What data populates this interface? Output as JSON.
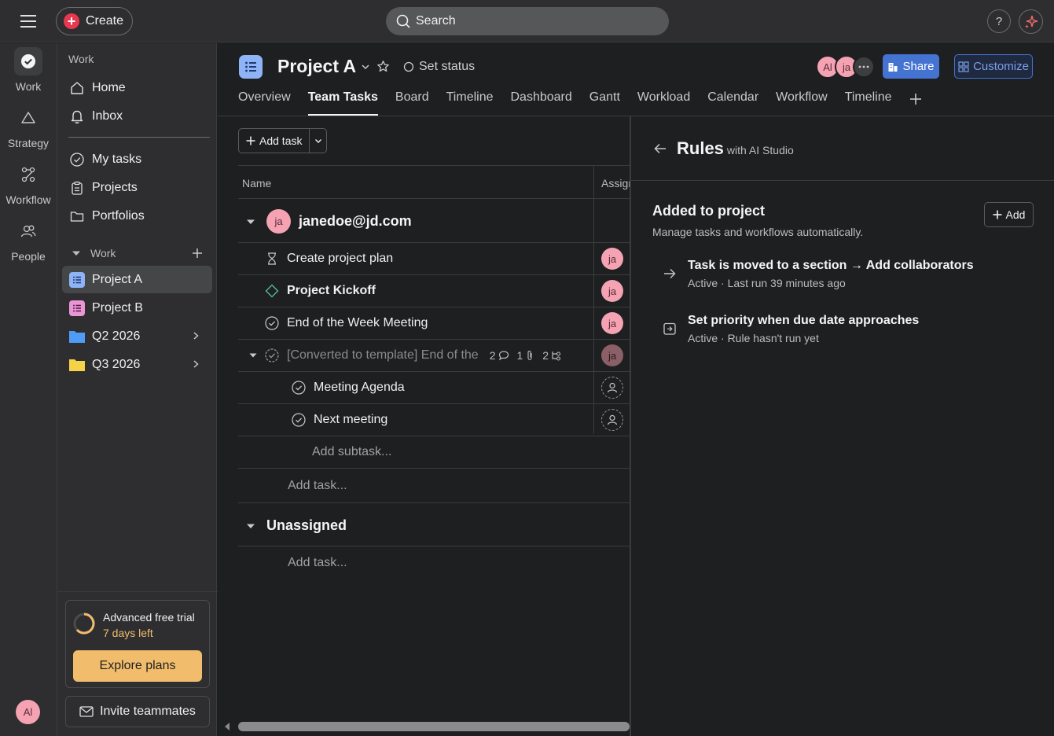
{
  "topbar": {
    "create_label": "Create",
    "search_placeholder": "Search",
    "help_label": "?"
  },
  "rail": {
    "items": [
      {
        "label": "Work",
        "icon": "check-circle-icon"
      },
      {
        "label": "Strategy",
        "icon": "triangle-icon"
      },
      {
        "label": "Workflow",
        "icon": "workflow-icon"
      },
      {
        "label": "People",
        "icon": "people-icon"
      }
    ],
    "user_initials": "Al"
  },
  "sidebar": {
    "heading": "Work",
    "nav": [
      {
        "label": "Home",
        "icon": "home-icon"
      },
      {
        "label": "Inbox",
        "icon": "bell-icon"
      }
    ],
    "personal": [
      {
        "label": "My tasks",
        "icon": "check-circle-icon"
      },
      {
        "label": "Projects",
        "icon": "clipboard-icon"
      },
      {
        "label": "Portfolios",
        "icon": "folder-icon"
      }
    ],
    "section_label": "Work",
    "projects": [
      {
        "label": "Project A",
        "color": "#8fb3f7"
      },
      {
        "label": "Project B",
        "color": "#e996d6"
      }
    ],
    "folders": [
      {
        "label": "Q2 2026",
        "color": "#4f9cf7"
      },
      {
        "label": "Q3 2026",
        "color": "#f5d247"
      }
    ],
    "trial": {
      "title": "Advanced free trial",
      "days_left": "7 days left",
      "explore_label": "Explore plans"
    },
    "invite_label": "Invite teammates"
  },
  "header": {
    "project_title": "Project A",
    "set_status_label": "Set status",
    "avatars": [
      "Al",
      "ja"
    ],
    "share_label": "Share",
    "customize_label": "Customize",
    "tabs": [
      "Overview",
      "Team Tasks",
      "Board",
      "Timeline",
      "Dashboard",
      "Gantt",
      "Workload",
      "Calendar",
      "Workflow",
      "Timeline"
    ],
    "active_tab": "Team Tasks"
  },
  "tasks": {
    "add_task_label": "Add task",
    "col_name": "Name",
    "col_assignee": "Assign",
    "group1": {
      "title": "janedoe@jd.com",
      "avatar": "ja",
      "rows": [
        {
          "name": "Create project plan",
          "assignee": "ja",
          "icon": "hourglass-icon"
        },
        {
          "name": "Project Kickoff",
          "assignee": "ja",
          "icon": "milestone-diamond-icon"
        },
        {
          "name": "End of the Week Meeting",
          "assignee": "ja",
          "icon": "check-circle-icon"
        },
        {
          "name": "[Converted to template] End of the",
          "assignee": "ja",
          "icon": "check-circle-icon",
          "comments": "2",
          "attachments": "1",
          "subtasks": "2"
        }
      ],
      "subtasks": [
        {
          "name": "Meeting Agenda"
        },
        {
          "name": "Next meeting"
        }
      ],
      "add_subtask_label": "Add subtask...",
      "add_task_label": "Add task..."
    },
    "group2": {
      "title": "Unassigned",
      "add_task_label": "Add task..."
    }
  },
  "rules": {
    "title": "Rules",
    "subtitle": "with AI Studio",
    "section_title": "Added to project",
    "section_sub": "Manage tasks and workflows automatically.",
    "add_label": "Add",
    "items": [
      {
        "title": "Task is moved to a section → Add collaborators",
        "status": "Active · Last run 39 minutes ago",
        "icon": "arrow-right-icon"
      },
      {
        "title": "Set priority when due date approaches",
        "status": "Active · Rule hasn't run yet",
        "icon": "rule-calendar-icon"
      }
    ]
  },
  "colors": {
    "accent": "#4573d2",
    "trial": "#f1bd6c",
    "create": "#e8384f",
    "avatar_pink": "#f5a3b3"
  }
}
